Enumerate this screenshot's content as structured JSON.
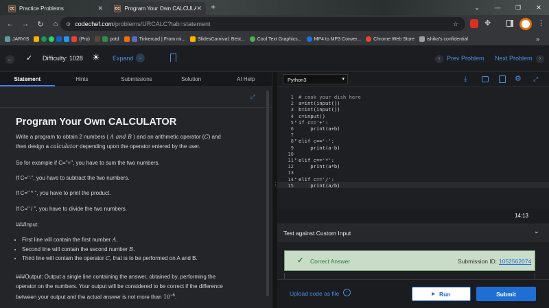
{
  "browser": {
    "tabs": [
      {
        "favicon": "CC",
        "title": "Practice Problems",
        "close": "✕"
      },
      {
        "favicon": "CC",
        "title": "Program Your Own CALCULATO",
        "close": "✕"
      }
    ],
    "new_tab": "+",
    "url_host": "codechef.com",
    "url_path": "/problems/URCALC?tab=statement",
    "bookmarks": [
      "JARVIS",
      "(Pro)",
      "potd",
      "Tinkercad | From mi...",
      "SlidesCarnival: Best...",
      "Cool Text Graphics...",
      "MP4 to MP3 Conver...",
      "Chrome Web Store",
      "ishika's confidential"
    ],
    "bookmarks_more": "»"
  },
  "topbar": {
    "difficulty": "Difficulty: 1028",
    "expand": "Expand",
    "prev": "Prev Problem",
    "next": "Next Problem"
  },
  "tabs": [
    "Statement",
    "Hints",
    "Submissions",
    "Solution",
    "AI Help"
  ],
  "problem": {
    "title": "Program Your Own CALCULATOR",
    "intro_a": "Write a program to obtain 2 numbers (",
    "intro_math1": "A and B",
    "intro_b": ") and an arithmetic operator (",
    "intro_math2": "C",
    "intro_c": ") and",
    "intro_d": "then design a",
    "intro_math3": "calculator",
    "intro_e": "depending upon the operator entered by the user.",
    "lines": [
      "So for example if C=\"+\", you have to sum the two numbers.",
      "If C=\"-\", you have to subtract the two numbers.",
      "If C=\" * \", you have to print the product.",
      "If C=\" / \", you have to divide the two numbers.",
      "###Input:"
    ],
    "input_items": [
      {
        "text": "First line will contain the first number",
        "math": "A."
      },
      {
        "text": "Second line will contain the second number",
        "math": "B."
      },
      {
        "text": "Third line will contain the operator",
        "math": "C,",
        "rest": " that is to be performed on A and B."
      }
    ],
    "output_1": "###Output: Output a single line containing the answer, obtained by, performing the",
    "output_2": "operator on the numbers. Your output will be considered to be correct if the difference",
    "output_3": "between your output and the actual answer is not more than",
    "output_exp": "10",
    "output_sup": "−6",
    "output_end": "."
  },
  "editor": {
    "language": "Python3",
    "lines": [
      "# cook your dish here",
      "a=int(input())",
      "b=int(input())",
      "c=input()",
      "if c=='+':",
      "    print(a+b)",
      "",
      "elif c=='-':",
      "    print(a-b)",
      "",
      "elif c=='*':",
      "    print(a*b)",
      "",
      "elif c=='/':",
      "    print(a/b)"
    ],
    "folds": [
      5,
      8,
      11,
      14
    ],
    "time": "14:13"
  },
  "custom_input": {
    "label": "Test against Custom Input"
  },
  "result": {
    "status": "Correct Answer",
    "submission_label": "Submission ID:",
    "submission_id": "1052562074"
  },
  "footer": {
    "upload": "Upload code as file",
    "run": "Run",
    "submit": "Submit"
  },
  "colors": {
    "accent": "#1f6ed4",
    "success_bg": "#c9dcc8",
    "success_text": "#2e7d32"
  }
}
